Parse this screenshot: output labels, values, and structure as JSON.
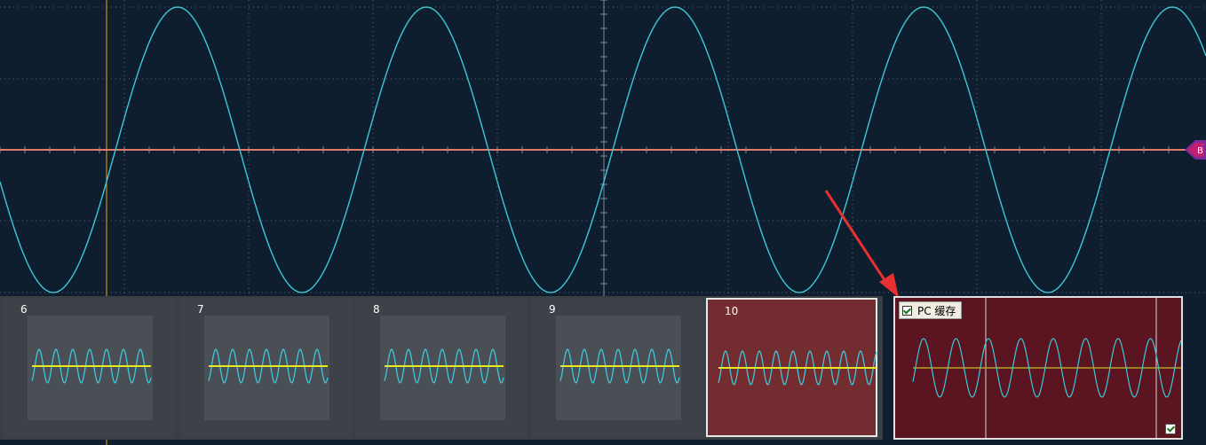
{
  "colors": {
    "background": "#0e1e2e",
    "grid": "#6d7b88",
    "waveform": "#3ec8d8",
    "reference_line": "#e07a6a",
    "cursor": "#e8a020",
    "thumb_trace": "#e8e820",
    "selected_thumb": "#732c30",
    "pc_buffer_bg": "#5a1520",
    "arrow": "#e83030"
  },
  "channel_marker": {
    "label": "B",
    "color": "#7a2aa0"
  },
  "thumbnails": [
    {
      "number": "6",
      "selected": false
    },
    {
      "number": "7",
      "selected": false
    },
    {
      "number": "8",
      "selected": false
    },
    {
      "number": "9",
      "selected": false
    },
    {
      "number": "10",
      "selected": true
    }
  ],
  "pc_buffer": {
    "label": "PC 缓存",
    "checked": true,
    "corner_checked": true
  }
}
